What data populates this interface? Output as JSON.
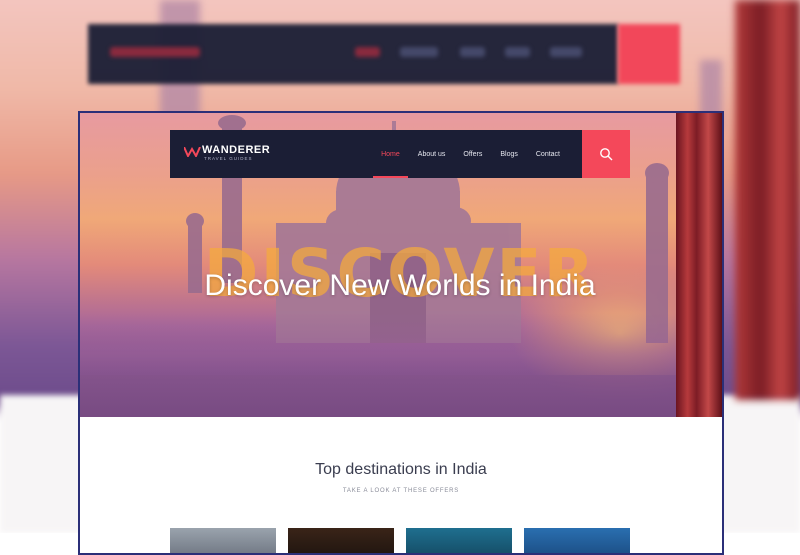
{
  "site": {
    "logo_text": "WANDERER",
    "logo_subtitle": "TRAVEL GUIDES"
  },
  "nav": {
    "items": [
      {
        "label": "Home",
        "active": true
      },
      {
        "label": "About us",
        "active": false
      },
      {
        "label": "Offers",
        "active": false
      },
      {
        "label": "Blogs",
        "active": false
      },
      {
        "label": "Contact",
        "active": false
      }
    ],
    "search_icon": "search-icon"
  },
  "hero": {
    "background_word": "DISCOVER",
    "headline": "Discover New Worlds in India"
  },
  "destinations": {
    "title": "Top destinations in India",
    "subtitle": "TAKE A LOOK AT THESE OFFERS"
  },
  "colors": {
    "nav_bg": "#1b1e35",
    "accent": "#f4485a",
    "frame_border": "#2b2f78"
  }
}
